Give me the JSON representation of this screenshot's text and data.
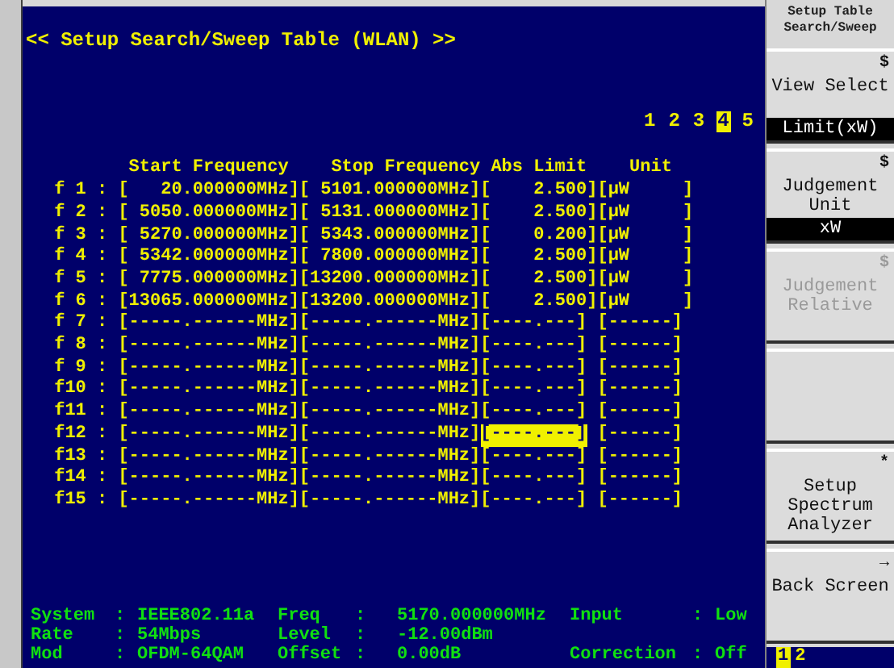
{
  "title": "<< Setup Search/Sweep Table (WLAN) >>",
  "pages": [
    {
      "label": "1",
      "selected": false
    },
    {
      "label": "2",
      "selected": false
    },
    {
      "label": "3",
      "selected": false
    },
    {
      "label": "4",
      "selected": true
    },
    {
      "label": "5",
      "selected": false
    }
  ],
  "table": {
    "columns": [
      "Start Frequency",
      "Stop Frequency",
      "Abs Limit",
      "Unit"
    ],
    "rows": [
      {
        "label": "f 1 :",
        "cells": [
          "[   20.000000MHz]",
          "[ 5101.000000MHz]",
          "[    2.500]",
          "[μW     ]"
        ],
        "limit_selected": false
      },
      {
        "label": "f 2 :",
        "cells": [
          "[ 5050.000000MHz]",
          "[ 5131.000000MHz]",
          "[    2.500]",
          "[μW     ]"
        ],
        "limit_selected": false
      },
      {
        "label": "f 3 :",
        "cells": [
          "[ 5270.000000MHz]",
          "[ 5343.000000MHz]",
          "[    0.200]",
          "[μW     ]"
        ],
        "limit_selected": false
      },
      {
        "label": "f 4 :",
        "cells": [
          "[ 5342.000000MHz]",
          "[ 7800.000000MHz]",
          "[    2.500]",
          "[μW     ]"
        ],
        "limit_selected": false
      },
      {
        "label": "f 5 :",
        "cells": [
          "[ 7775.000000MHz]",
          "[13200.000000MHz]",
          "[    2.500]",
          "[μW     ]"
        ],
        "limit_selected": false
      },
      {
        "label": "f 6 :",
        "cells": [
          "[13065.000000MHz]",
          "[13200.000000MHz]",
          "[    2.500]",
          "[μW     ]"
        ],
        "limit_selected": false
      },
      {
        "label": "f 7 :",
        "cells": [
          "[-----.------MHz]",
          "[-----.------MHz]",
          "[----.---]",
          "[------]"
        ],
        "limit_selected": false
      },
      {
        "label": "f 8 :",
        "cells": [
          "[-----.------MHz]",
          "[-----.------MHz]",
          "[----.---]",
          "[------]"
        ],
        "limit_selected": false
      },
      {
        "label": "f 9 :",
        "cells": [
          "[-----.------MHz]",
          "[-----.------MHz]",
          "[----.---]",
          "[------]"
        ],
        "limit_selected": false
      },
      {
        "label": "f10 :",
        "cells": [
          "[-----.------MHz]",
          "[-----.------MHz]",
          "[----.---]",
          "[------]"
        ],
        "limit_selected": false
      },
      {
        "label": "f11 :",
        "cells": [
          "[-----.------MHz]",
          "[-----.------MHz]",
          "[----.---]",
          "[------]"
        ],
        "limit_selected": false
      },
      {
        "label": "f12 :",
        "cells": [
          "[-----.------MHz]",
          "[-----.------MHz]",
          "[----.---]",
          "[------]"
        ],
        "limit_selected": true
      },
      {
        "label": "f13 :",
        "cells": [
          "[-----.------MHz]",
          "[-----.------MHz]",
          "[----.---]",
          "[------]"
        ],
        "limit_selected": false
      },
      {
        "label": "f14 :",
        "cells": [
          "[-----.------MHz]",
          "[-----.------MHz]",
          "[----.---]",
          "[------]"
        ],
        "limit_selected": false
      },
      {
        "label": "f15 :",
        "cells": [
          "[-----.------MHz]",
          "[-----.------MHz]",
          "[----.---]",
          "[------]"
        ],
        "limit_selected": false
      }
    ]
  },
  "status": [
    [
      {
        "label": "System",
        "separator": ":",
        "value": "IEEE802.11a"
      },
      {
        "label": "Freq",
        "separator": ":",
        "value": "5170.000000MHz"
      },
      {
        "label": "Input",
        "separator": ":",
        "value": "Low"
      }
    ],
    [
      {
        "label": "Rate",
        "separator": ":",
        "value": "54Mbps"
      },
      {
        "label": "Level",
        "separator": ":",
        "value": "-12.00dBm"
      }
    ],
    [
      {
        "label": "Mod",
        "separator": ":",
        "value": "OFDM-64QAM"
      },
      {
        "label": "Offset",
        "separator": ":",
        "value": "0.00dB"
      },
      {
        "label": "Correction",
        "separator": ":",
        "value": "Off"
      }
    ]
  ],
  "softkey_menu": {
    "title": "Setup Table Search/Sweep",
    "keys": [
      {
        "kind": "key",
        "indicator": "$",
        "label": "View Select",
        "value": "Limit(xW)",
        "disabled": false
      },
      {
        "kind": "key",
        "indicator": "$",
        "label": "Judgement Unit",
        "value": "xW",
        "disabled": false
      },
      {
        "kind": "key",
        "indicator": "$",
        "label": "Judgement Relative",
        "disabled": true
      },
      {
        "kind": "blank"
      },
      {
        "kind": "key",
        "indicator": "*",
        "label": "Setup Spectrum Analyzer",
        "disabled": false
      },
      {
        "kind": "key",
        "indicator": "→",
        "label": "Back Screen",
        "disabled": false
      }
    ],
    "pages": [
      {
        "label": "1",
        "selected": true
      },
      {
        "label": "2",
        "selected": false
      }
    ]
  }
}
